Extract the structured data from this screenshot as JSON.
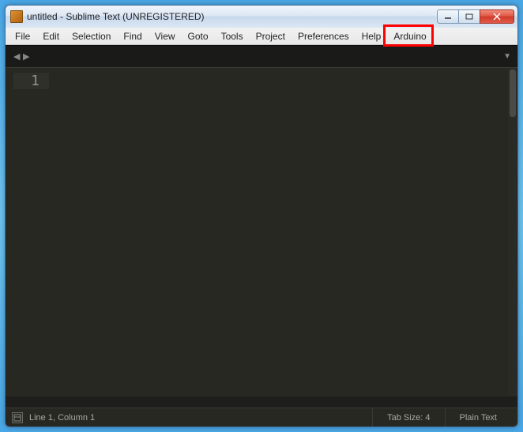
{
  "window": {
    "title": "untitled - Sublime Text (UNREGISTERED)"
  },
  "menu": {
    "items": [
      "File",
      "Edit",
      "Selection",
      "Find",
      "View",
      "Goto",
      "Tools",
      "Project",
      "Preferences",
      "Help",
      "Arduino"
    ],
    "highlighted": "Arduino"
  },
  "editor": {
    "line_number": "1"
  },
  "status": {
    "position": "Line 1, Column 1",
    "tab_size": "Tab Size: 4",
    "syntax": "Plain Text"
  }
}
